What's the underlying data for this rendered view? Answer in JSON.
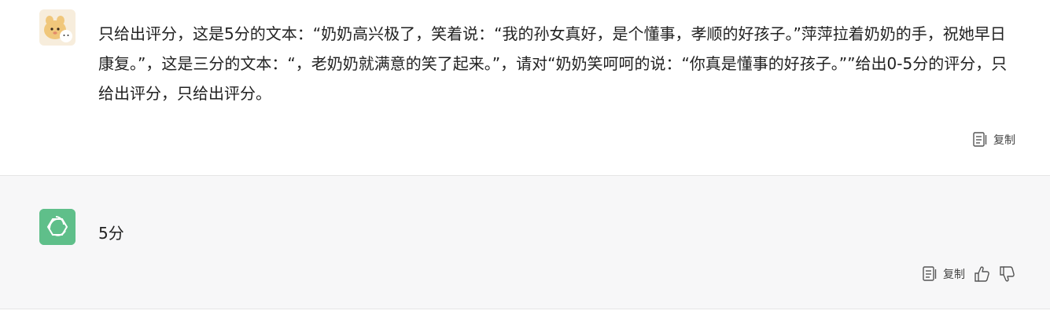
{
  "messages": [
    {
      "role": "user",
      "text": "只给出评分，这是5分的文本：“奶奶高兴极了，笑着说：“我的孙女真好，是个懂事，孝顺的好孩子。”萍萍拉着奶奶的手，祝她早日康复。”，这是三分的文本：“，老奶奶就满意的笑了起来。”，请对“奶奶笑呵呵的说：“你真是懂事的好孩子。””给出0-5分的评分，只给出评分，只给出评分。",
      "actions": {
        "copy_label": "复制",
        "copy_icon": "copy-icon"
      }
    },
    {
      "role": "assistant",
      "text": "5分",
      "actions": {
        "copy_label": "复制",
        "copy_icon": "copy-icon",
        "like_icon": "thumbs-up-icon",
        "dislike_icon": "thumbs-down-icon"
      }
    }
  ],
  "colors": {
    "assistant_avatar_bg": "#5fbf8a",
    "assistant_bg": "#f7f7f8",
    "divider": "#e5e5e5"
  }
}
